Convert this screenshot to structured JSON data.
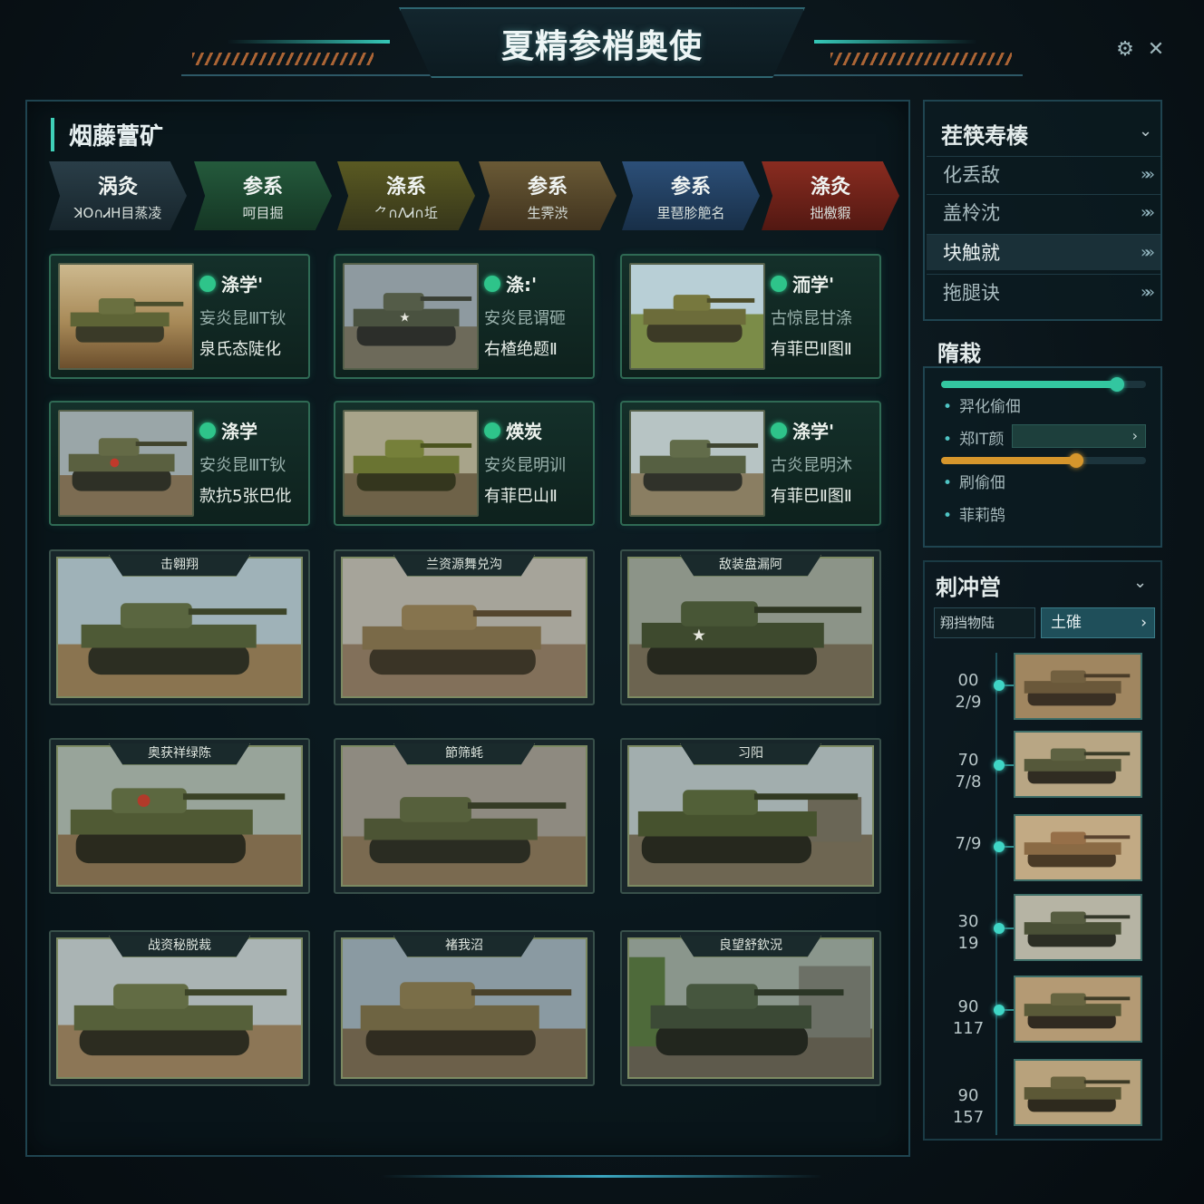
{
  "header": {
    "title": "夏精参梢奥使",
    "settings_icon": "settings-icon",
    "close_icon": "close-icon"
  },
  "main": {
    "section_title": "烟藤䔰矿",
    "tabs": [
      {
        "line1": "涡灸",
        "line2": "ꓘO∩ᏗH目蒸凌"
      },
      {
        "line1": "参系",
        "line2": "呵目掘"
      },
      {
        "line1": "涤系",
        "line2": "⺈∩ꓥᏗ∩坵"
      },
      {
        "line1": "参系",
        "line2": "生霁渋"
      },
      {
        "line1": "参系",
        "line2": "里琶胗䈈名"
      },
      {
        "line1": "涤灸",
        "line2": "拙檄貑"
      }
    ],
    "small_cards": [
      {
        "name": "涤学'",
        "line2": "妄炎昆ⅢT钬",
        "line3": "泉氏态陡化"
      },
      {
        "name": "涤:'",
        "line2": "安炎昆谓砸",
        "line3": "右楂绝题Ⅱ"
      },
      {
        "name": "洏学'",
        "line2": "古惊昆甘涤",
        "line3": "有菲巴Ⅱ图Ⅱ"
      },
      {
        "name": "涤学",
        "line2": "安炎昆ⅢT钬",
        "line3": "款抗5张巴仳"
      },
      {
        "name": "煐炭",
        "line2": "安炎昆明训",
        "line3": "有菲巴山Ⅱ"
      },
      {
        "name": "涤学'",
        "line2": "古炎昆明沐",
        "line3": "有菲巴Ⅱ图Ⅱ"
      }
    ],
    "big_cards": [
      {
        "label": "击翱翔"
      },
      {
        "label": "兰资源舞兑沟"
      },
      {
        "label": "敌装盘漏阿"
      },
      {
        "label": "奥获祥绿陈"
      },
      {
        "label": "節筛蚝"
      },
      {
        "label": "习阳"
      },
      {
        "label": "战资秘脱裁"
      },
      {
        "label": "褚我沼"
      },
      {
        "label": "良望舒欽況"
      }
    ]
  },
  "sidebar": {
    "nav_title": "茬筷寿楱",
    "nav_items": [
      {
        "label": "化丢敌"
      },
      {
        "label": "盖柃沈"
      },
      {
        "label": "块触就"
      },
      {
        "label": "拖腿诀"
      }
    ],
    "settings_title": "隋栽",
    "settings": {
      "opt1": "羿化偷佃",
      "opt2": "郑IT颜",
      "opt3": "刷偷佃",
      "opt4": "菲莉鹄",
      "slider1_value": 0.86,
      "slider2_value": 0.66,
      "slider1_color": "#33c6a0",
      "slider2_color": "#d6962c"
    },
    "timeline_title": "刺冲営",
    "filter_placeholder": "翔挡物陆",
    "filter_button": "土碓",
    "timeline": [
      {
        "top": "00",
        "bottom": "2/9"
      },
      {
        "top": "70",
        "bottom": "7/8"
      },
      {
        "top": "",
        "bottom": "7/9"
      },
      {
        "top": "30",
        "bottom": "19"
      },
      {
        "top": "90",
        "bottom": "117"
      },
      {
        "top": "90",
        "bottom": "157"
      }
    ]
  }
}
